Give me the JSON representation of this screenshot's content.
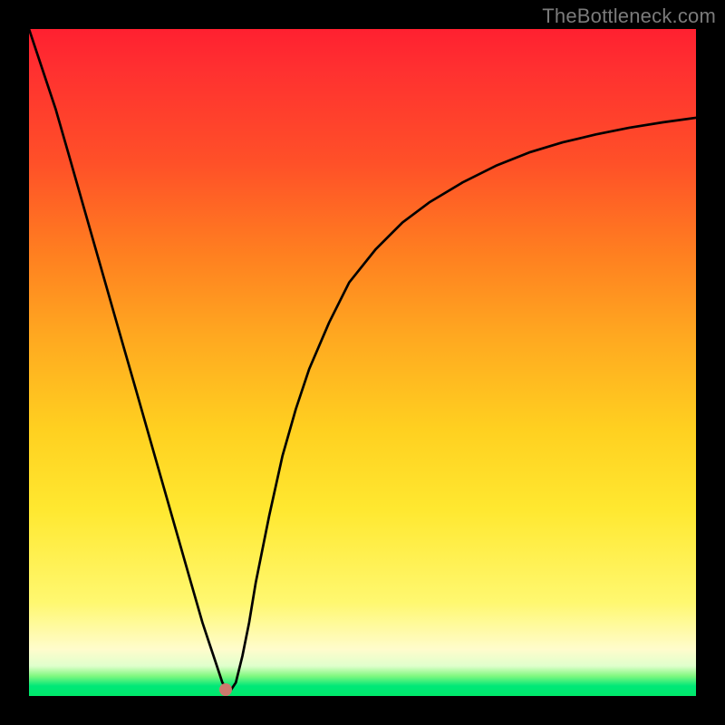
{
  "attribution": "TheBottleneck.com",
  "dot": {
    "x_pct": 29.5,
    "y_pct": 99.0,
    "color": "#cc7a6e"
  },
  "chart_data": {
    "type": "line",
    "title": "",
    "xlabel": "",
    "ylabel": "",
    "xlim": [
      0,
      100
    ],
    "ylim": [
      0,
      100
    ],
    "grid": false,
    "legend": false,
    "x": [
      0,
      2,
      4,
      6,
      8,
      10,
      12,
      14,
      16,
      18,
      20,
      22,
      24,
      26,
      27,
      28,
      29,
      30,
      31,
      32,
      33,
      34,
      36,
      38,
      40,
      42,
      45,
      48,
      52,
      56,
      60,
      65,
      70,
      75,
      80,
      85,
      90,
      95,
      100
    ],
    "y": [
      100,
      94,
      88,
      81,
      74,
      67,
      60,
      53,
      46,
      39,
      32,
      25,
      18,
      11,
      8,
      5,
      2,
      0.5,
      2,
      6,
      11,
      17,
      27,
      36,
      43,
      49,
      56,
      62,
      67,
      71,
      74,
      77,
      79.5,
      81.5,
      83,
      84.2,
      85.2,
      86,
      86.7
    ],
    "notes": "Curve descends near-linearly from top-left, bottoms near x≈30, then rises asymptotically toward ~87."
  }
}
